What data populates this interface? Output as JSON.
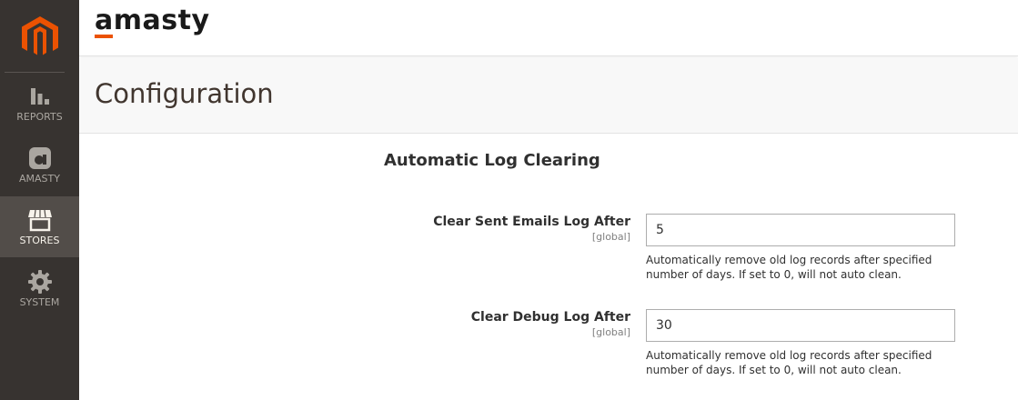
{
  "colors": {
    "sidebar_bg": "#373330",
    "sidebar_active": "#524d49",
    "magento_orange": "#eb5202",
    "brand_accent": "#eb5202"
  },
  "sidebar": {
    "logo_icon": "magento-logo-icon",
    "items": [
      {
        "label": "REPORTS",
        "icon": "bar-chart-icon",
        "active": false
      },
      {
        "label": "AMASTY",
        "icon": "amasty-icon",
        "active": false
      },
      {
        "label": "STORES",
        "icon": "storefront-icon",
        "active": true
      },
      {
        "label": "SYSTEM",
        "icon": "gear-icon",
        "active": false
      }
    ]
  },
  "topbar": {
    "brand": "amasty"
  },
  "header": {
    "title": "Configuration"
  },
  "section": {
    "title": "Automatic Log Clearing",
    "fields": [
      {
        "label": "Clear Sent Emails Log After",
        "scope": "[global]",
        "value": "5",
        "note": "Automatically remove old log records after specified number of days. If set to 0, will not auto clean."
      },
      {
        "label": "Clear Debug Log After",
        "scope": "[global]",
        "value": "30",
        "note": "Automatically remove old log records after specified number of days. If set to 0, will not auto clean."
      }
    ]
  }
}
